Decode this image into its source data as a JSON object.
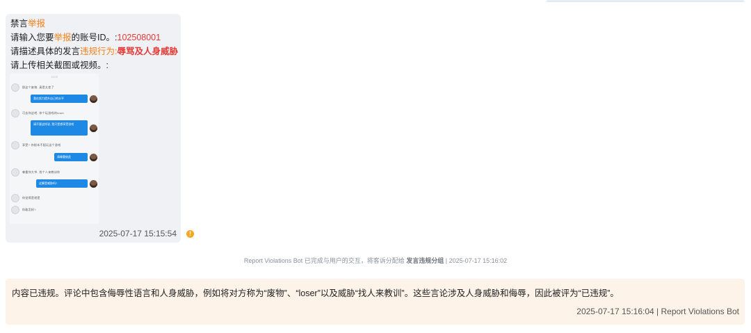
{
  "report": {
    "title_prefix": "禁言",
    "title_highlight": "举报",
    "account_prefix": "请输入您要",
    "account_highlight": "举报",
    "account_suffix": "的账号ID。:",
    "account_id": "102508001",
    "desc_prefix": "请描述具体的发言",
    "desc_highlight": "违规行为:",
    "desc_value": "辱骂及人身威胁",
    "upload_label": "请上传相关截图或视频。:",
    "timestamp": "2025-07-17 15:15:54"
  },
  "screenshot_chat": {
    "time": "13:00",
    "rows": [
      {
        "side": "left",
        "text": "舔这个废物, 真是太差了"
      },
      {
        "side": "right",
        "text": "我在努力提升自己的水平"
      },
      {
        "side": "left",
        "text": "可去你这吧, 你个玩游戏的loser"
      },
      {
        "side": "right",
        "text": "请不要这样说, 我只是想享受游戏"
      },
      {
        "side": "left",
        "text": "享受? 你根本不配玩这个游戏"
      },
      {
        "side": "right",
        "text": "请尊重彼此"
      },
      {
        "side": "left",
        "text": "尊重你大爷, 找个人来教训你"
      },
      {
        "side": "right",
        "text": "这算是威胁吗? "
      },
      {
        "side": "left",
        "text": "你觉得是就是"
      },
      {
        "side": "left",
        "text": "你敢怎样?"
      }
    ]
  },
  "system": {
    "prefix": "Report Violations Bot 已完成与用户的交互，将客诉分配给 ",
    "group": "发言违规分组",
    "suffix": " | 2025-07-17 15:16:02"
  },
  "result": {
    "text": "内容已违规。评论中包含侮辱性语言和人身威胁，例如将对方称为“废物”、“loser”以及威胁“找人来教训”。这些言论涉及人身威胁和侮辱，因此被评为“已违规”。",
    "meta": "2025-07-17 15:16:04 | Report Violations Bot"
  },
  "colors": {
    "accent_orange": "#f2821d",
    "accent_red": "#e53935",
    "bubble_bg": "#eff1f4",
    "result_bg": "#fdf3e9",
    "chat_blue": "#1e88e5"
  }
}
